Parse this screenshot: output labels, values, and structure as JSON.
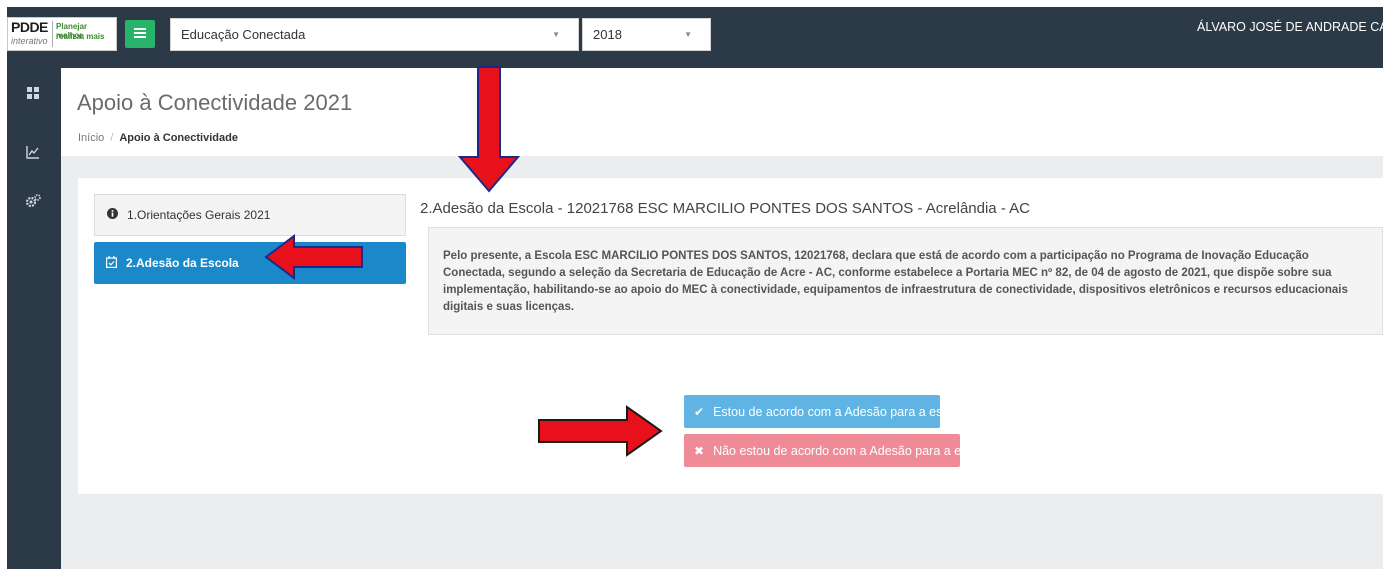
{
  "logo": {
    "brand": "PDDE",
    "sub": "interativo",
    "slogan_line1": "Planejar melhor,",
    "slogan_line2": "realizar mais"
  },
  "topbar": {
    "program_select": "Educação Conectada",
    "year_select": "2018",
    "user_name": "ÁLVARO JOSÉ DE ANDRADE CAR"
  },
  "sidebar": {
    "icons": [
      "dashboard-icon",
      "chart-line-icon",
      "gears-icon"
    ]
  },
  "header": {
    "title": "Apoio à Conectividade 2021",
    "breadcrumb": {
      "home": "Início",
      "separator": "/",
      "current": "Apoio à Conectividade"
    }
  },
  "steps": [
    {
      "label": "1.Orientações Gerais 2021",
      "icon": "info-circle-icon",
      "active": false
    },
    {
      "label": "2.Adesão da Escola",
      "icon": "calendar-check-icon",
      "active": true
    }
  ],
  "section": {
    "title": "2.Adesão da Escola - 12021768 ESC MARCILIO PONTES DOS SANTOS - Acrelândia - AC",
    "body": "Pelo presente, a Escola ESC MARCILIO PONTES DOS SANTOS, 12021768, declara que está de acordo com a participação no Programa de Inovação Educação Conectada, segundo a seleção da Secretaria de Educação de Acre - AC, conforme estabelece a Portaria MEC nº 82, de 04 de agosto de 2021, que dispõe sobre sua implementação, habilitando-se ao apoio do MEC à conectividade, equipamentos de infraestrutura de conectividade, dispositivos eletrônicos e recursos educacionais digitais e suas licenças."
  },
  "actions": {
    "accept_label": "Estou de acordo com a Adesão para a escola",
    "reject_label": "Não estou de acordo com a Adesão para a escola"
  },
  "colors": {
    "topbar": "#2c3a48",
    "menu_button": "#27b46a",
    "active_step": "#1a88c9",
    "accept": "#5fb4e4",
    "reject": "#ef8b96",
    "annotation_arrow": "#e8101a"
  }
}
